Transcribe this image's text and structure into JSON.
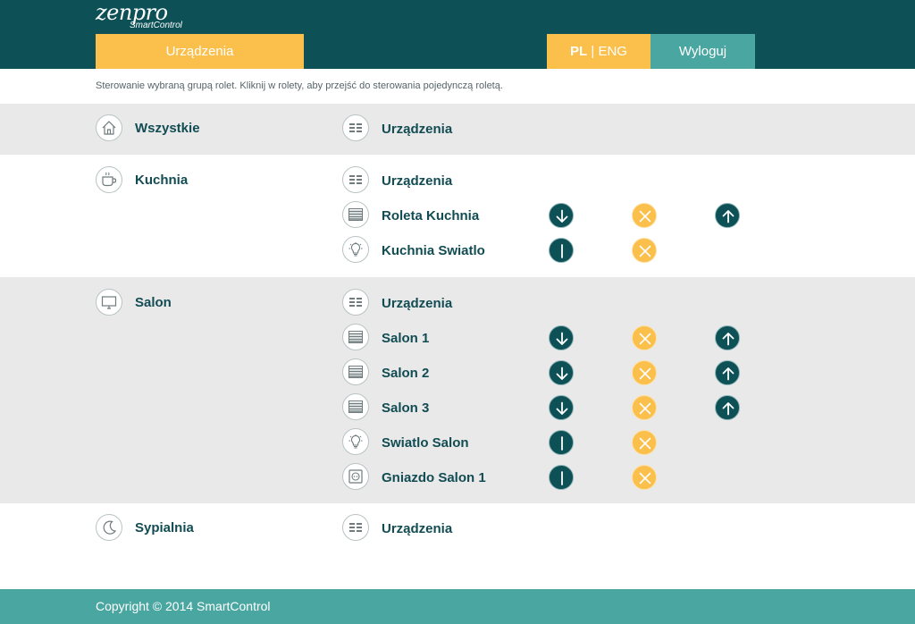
{
  "header": {
    "logo_main": "zenpro",
    "logo_sub": "SmartControl",
    "nav_devices": "Urządzenia",
    "lang_pl": "PL",
    "lang_sep": " | ",
    "lang_eng": "ENG",
    "logout": "Wyloguj"
  },
  "hint": "Sterowanie wybraną grupą rolet. Kliknij w rolety, aby przejść do sterowania pojedynczą roletą.",
  "groups": [
    {
      "name": "Wszystkie",
      "icon": "house-icon",
      "shaded": true,
      "devices": [
        {
          "name": "Urządzenia",
          "icon": "devices-icon",
          "controls": []
        }
      ]
    },
    {
      "name": "Kuchnia",
      "icon": "cup-icon",
      "shaded": false,
      "devices": [
        {
          "name": "Urządzenia",
          "icon": "devices-icon",
          "controls": []
        },
        {
          "name": "Roleta Kuchnia",
          "icon": "blind-icon",
          "controls": [
            "down",
            "stop",
            "up"
          ]
        },
        {
          "name": "Kuchnia Swiatlo",
          "icon": "bulb-icon",
          "controls": [
            "on",
            "off"
          ]
        }
      ]
    },
    {
      "name": "Salon",
      "icon": "tv-icon",
      "shaded": true,
      "devices": [
        {
          "name": "Urządzenia",
          "icon": "devices-icon",
          "controls": []
        },
        {
          "name": "Salon 1",
          "icon": "blind-icon",
          "controls": [
            "down",
            "stop",
            "up"
          ]
        },
        {
          "name": "Salon 2",
          "icon": "blind-icon",
          "controls": [
            "down",
            "stop",
            "up"
          ]
        },
        {
          "name": "Salon 3",
          "icon": "blind-icon",
          "controls": [
            "down",
            "stop",
            "up"
          ]
        },
        {
          "name": "Swiatlo Salon",
          "icon": "bulb-icon",
          "controls": [
            "on",
            "off"
          ]
        },
        {
          "name": "Gniazdo Salon 1",
          "icon": "socket-icon",
          "controls": [
            "on",
            "off"
          ]
        }
      ]
    },
    {
      "name": "Sypialnia",
      "icon": "moon-icon",
      "shaded": false,
      "devices": [
        {
          "name": "Urządzenia",
          "icon": "devices-icon",
          "controls": []
        }
      ]
    }
  ],
  "footer": {
    "copyright": "Copyright © 2014 SmartControl"
  },
  "colors": {
    "header_bg": "#0d5157",
    "accent_orange": "#fbbf4c",
    "accent_teal": "#4aa6a1",
    "label_text": "#124c53",
    "band_bg": "#e9e9e9"
  }
}
